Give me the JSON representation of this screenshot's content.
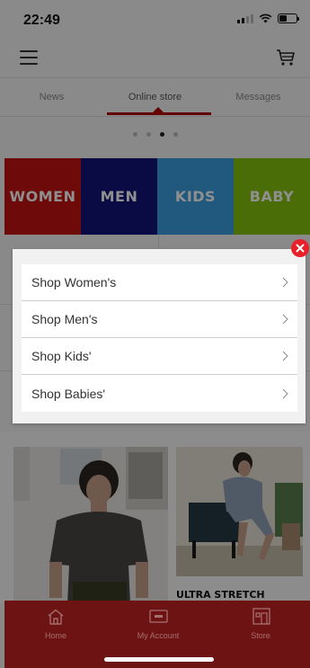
{
  "status": {
    "time": "22:49"
  },
  "tabs": [
    {
      "label": "News"
    },
    {
      "label": "Online store"
    },
    {
      "label": "Messages"
    }
  ],
  "carousel": {
    "page_count": 4,
    "active_index": 2
  },
  "categories": [
    {
      "label": "WOMEN",
      "color": "#c41313"
    },
    {
      "label": "MEN",
      "color": "#13157a"
    },
    {
      "label": "KIDS",
      "color": "#3a9ee0"
    },
    {
      "label": "BABY",
      "color": "#86c20f"
    }
  ],
  "modal": {
    "items": [
      {
        "label": "Shop Women's"
      },
      {
        "label": "Shop Men's"
      },
      {
        "label": "Shop Kids'"
      },
      {
        "label": "Shop Babies'"
      }
    ]
  },
  "products": {
    "caption": "ULTRA STRETCH"
  },
  "bottom_nav": [
    {
      "label": "Home",
      "icon": "home-icon"
    },
    {
      "label": "My Account",
      "icon": "membership-card-icon"
    },
    {
      "label": "Store",
      "icon": "store-icon"
    }
  ],
  "colors": {
    "brand_red": "#c41313",
    "close_red": "#e8202a"
  }
}
